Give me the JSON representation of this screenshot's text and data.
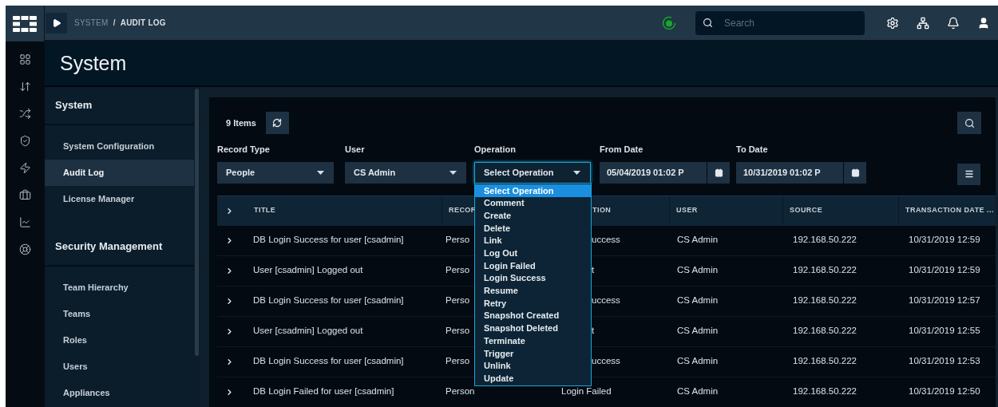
{
  "breadcrumb": {
    "items": [
      {
        "label": "SYSTEM",
        "current": false
      },
      {
        "label": "AUDIT LOG",
        "current": true
      }
    ],
    "separator": "/"
  },
  "top_search": {
    "placeholder": "Search"
  },
  "page_title": "System",
  "sidebar": {
    "sections": [
      {
        "title": "System",
        "items": [
          {
            "label": "System Configuration",
            "selected": false
          },
          {
            "label": "Audit Log",
            "selected": true
          },
          {
            "label": "License Manager",
            "selected": false
          }
        ]
      },
      {
        "title": "Security Management",
        "items": [
          {
            "label": "Team Hierarchy",
            "selected": false
          },
          {
            "label": "Teams",
            "selected": false
          },
          {
            "label": "Roles",
            "selected": false
          },
          {
            "label": "Users",
            "selected": false
          },
          {
            "label": "Appliances",
            "selected": false
          }
        ]
      }
    ]
  },
  "toolbar": {
    "count": "9 Items"
  },
  "filters": [
    {
      "label": "Record Type",
      "kind": "select",
      "value": "People",
      "open": false
    },
    {
      "label": "User",
      "kind": "select",
      "value": "CS Admin",
      "open": false
    },
    {
      "label": "Operation",
      "kind": "select",
      "value": "Select Operation",
      "open": true
    },
    {
      "label": "From Date",
      "kind": "date",
      "value": "05/04/2019 01:02 P"
    },
    {
      "label": "To Date",
      "kind": "date",
      "value": "10/31/2019 01:02 P"
    }
  ],
  "operation_menu": [
    {
      "label": "Select Operation",
      "selected": true
    },
    {
      "label": "Comment",
      "selected": false
    },
    {
      "label": "Create",
      "selected": false
    },
    {
      "label": "Delete",
      "selected": false
    },
    {
      "label": "Link",
      "selected": false
    },
    {
      "label": "Log Out",
      "selected": false
    },
    {
      "label": "Login Failed",
      "selected": false
    },
    {
      "label": "Login Success",
      "selected": false
    },
    {
      "label": "Resume",
      "selected": false
    },
    {
      "label": "Retry",
      "selected": false
    },
    {
      "label": "Snapshot Created",
      "selected": false
    },
    {
      "label": "Snapshot Deleted",
      "selected": false
    },
    {
      "label": "Terminate",
      "selected": false
    },
    {
      "label": "Trigger",
      "selected": false
    },
    {
      "label": "Unlink",
      "selected": false
    },
    {
      "label": "Update",
      "selected": false
    }
  ],
  "table": {
    "columns": [
      {
        "label": "TITLE"
      },
      {
        "label": "RECOR"
      },
      {
        "label": "TION"
      },
      {
        "label": "USER"
      },
      {
        "label": "SOURCE"
      },
      {
        "label": "TRANSACTION DATE ..."
      }
    ],
    "rows": [
      {
        "title": "DB Login Success for user [csadmin]",
        "record": "Perso",
        "operation": "uccess",
        "operation_cut_by_menu": true,
        "user": "CS Admin",
        "source": "192.168.50.222",
        "date": "10/31/2019 12:59"
      },
      {
        "title": "User [csadmin] Logged out",
        "record": "Perso",
        "operation": "t",
        "operation_cut_by_menu": true,
        "user": "CS Admin",
        "source": "192.168.50.222",
        "date": "10/31/2019 12:59"
      },
      {
        "title": "DB Login Success for user [csadmin]",
        "record": "Perso",
        "operation": "uccess",
        "operation_cut_by_menu": true,
        "user": "CS Admin",
        "source": "192.168.50.222",
        "date": "10/31/2019 12:57"
      },
      {
        "title": "User [csadmin] Logged out",
        "record": "Perso",
        "operation": "t",
        "operation_cut_by_menu": true,
        "user": "CS Admin",
        "source": "192.168.50.222",
        "date": "10/31/2019 12:55"
      },
      {
        "title": "DB Login Success for user [csadmin]",
        "record": "Perso",
        "operation": "uccess",
        "operation_cut_by_menu": true,
        "user": "CS Admin",
        "source": "192.168.50.222",
        "date": "10/31/2019 12:53"
      },
      {
        "title": "DB Login Failed for user [csadmin]",
        "record": "Person",
        "operation": "Login Failed",
        "operation_cut_by_menu": false,
        "user": "CS Admin",
        "source": "192.168.50.222",
        "date": "10/31/2019 12:50"
      }
    ]
  }
}
